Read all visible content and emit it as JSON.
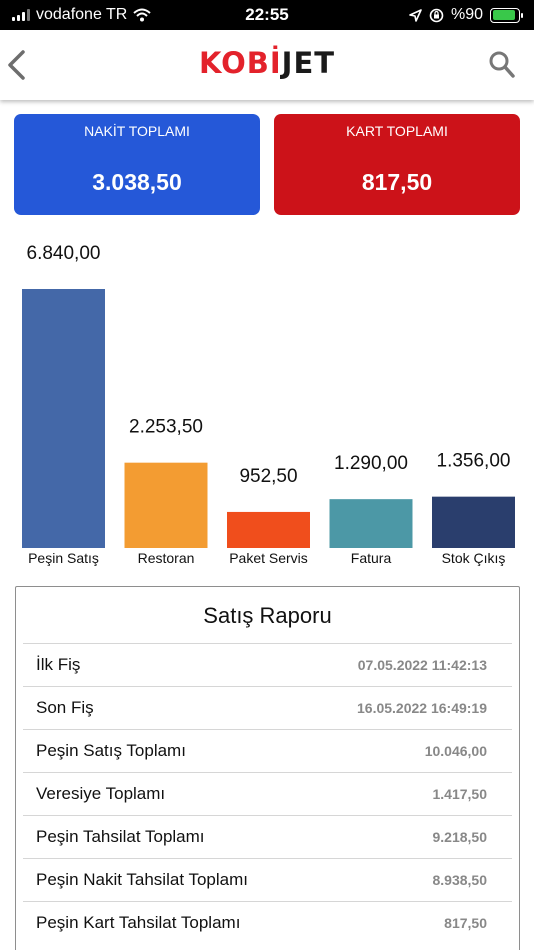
{
  "status_bar": {
    "carrier": "vodafone TR",
    "time": "22:55",
    "battery": "%90",
    "battery_level": 0.9
  },
  "header": {
    "logo_left": "KOBİ",
    "logo_right": "JET",
    "back_icon": "chevron-left-icon",
    "search_icon": "search-icon"
  },
  "totals": {
    "cash": {
      "label": "NAKİT TOPLAMI",
      "value": "3.038,50",
      "color": "#2558d8"
    },
    "card": {
      "label": "KART TOPLAMI",
      "value": "817,50",
      "color": "#cc1219"
    }
  },
  "chart_data": {
    "type": "bar",
    "categories": [
      "Peşin Satış",
      "Restoran",
      "Paket Servis",
      "Fatura",
      "Stok Çıkış"
    ],
    "values": [
      6840.0,
      2253.5,
      952.5,
      1290.0,
      1356.0
    ],
    "value_labels": [
      "6.840,00",
      "2.253,50",
      "952,50",
      "1.290,00",
      "1.356,00"
    ],
    "colors": [
      "#4468a8",
      "#f39c32",
      "#f04e1c",
      "#4c98a6",
      "#2a3e6d"
    ],
    "title": "",
    "xlabel": "",
    "ylabel": "",
    "ylim": [
      0,
      6840
    ],
    "grid": false
  },
  "report": {
    "title": "Satış Raporu",
    "rows": [
      {
        "label": "İlk Fiş",
        "value": "07.05.2022 11:42:13"
      },
      {
        "label": "Son Fiş",
        "value": "16.05.2022 16:49:19"
      },
      {
        "label": "Peşin Satış Toplamı",
        "value": "10.046,00"
      },
      {
        "label": "Veresiye Toplamı",
        "value": "1.417,50"
      },
      {
        "label": "Peşin Tahsilat Toplamı",
        "value": "9.218,50"
      },
      {
        "label": "Peşin Nakit Tahsilat Toplamı",
        "value": "8.938,50"
      },
      {
        "label": "Peşin Kart Tahsilat Toplamı",
        "value": "817,50"
      }
    ]
  }
}
